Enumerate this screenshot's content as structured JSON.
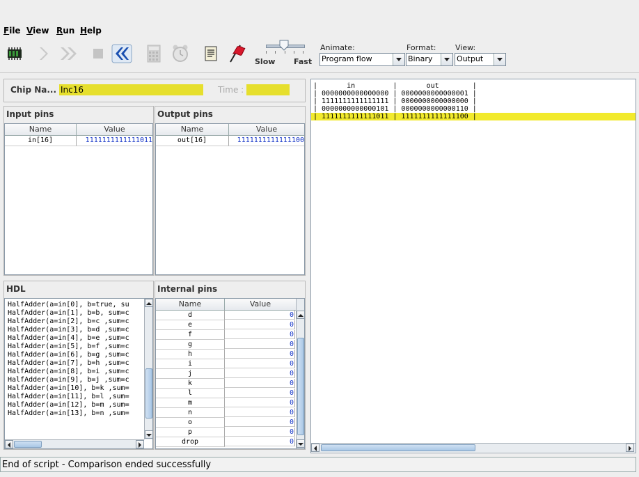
{
  "menu": {
    "file": {
      "accel": "F",
      "rest": "ile"
    },
    "view": {
      "accel": "V",
      "rest": "iew"
    },
    "run": {
      "accel": "R",
      "rest": "un"
    },
    "help": {
      "accel": "H",
      "rest": "elp"
    }
  },
  "toolbar": {
    "speed_slow": "Slow",
    "speed_fast": "Fast",
    "animate_label": "Animate:",
    "animate_value": "Program flow",
    "format_label": "Format:",
    "format_value": "Binary",
    "view_label": "View:",
    "view_value": "Output"
  },
  "chip": {
    "name_label": "Chip Na...",
    "name_value": "Inc16",
    "time_label": "Time :",
    "time_value": ""
  },
  "input_pins": {
    "title": "Input pins",
    "col_name": "Name",
    "col_value": "Value",
    "rows": [
      {
        "name": "in[16]",
        "value": "1111111111111011"
      }
    ]
  },
  "output_pins": {
    "title": "Output pins",
    "col_name": "Name",
    "col_value": "Value",
    "rows": [
      {
        "name": "out[16]",
        "value": "1111111111111100"
      }
    ]
  },
  "hdl": {
    "title": "HDL",
    "lines": [
      "HalfAdder(a=in[0], b=true, su",
      "HalfAdder(a=in[1], b=b, sum=c",
      "HalfAdder(a=in[2], b=c ,sum=c",
      "HalfAdder(a=in[3], b=d ,sum=c",
      "HalfAdder(a=in[4], b=e ,sum=c",
      "HalfAdder(a=in[5], b=f ,sum=c",
      "HalfAdder(a=in[6], b=g ,sum=c",
      "HalfAdder(a=in[7], b=h ,sum=c",
      "HalfAdder(a=in[8], b=i ,sum=c",
      "HalfAdder(a=in[9], b=j ,sum=c",
      "HalfAdder(a=in[10], b=k ,sum=",
      "HalfAdder(a=in[11], b=l ,sum=",
      "HalfAdder(a=in[12], b=m ,sum=",
      "HalfAdder(a=in[13], b=n ,sum="
    ]
  },
  "internal_pins": {
    "title": "Internal pins",
    "col_name": "Name",
    "col_value": "Value",
    "rows": [
      {
        "name": "d",
        "value": "0"
      },
      {
        "name": "e",
        "value": "0"
      },
      {
        "name": "f",
        "value": "0"
      },
      {
        "name": "g",
        "value": "0"
      },
      {
        "name": "h",
        "value": "0"
      },
      {
        "name": "i",
        "value": "0"
      },
      {
        "name": "j",
        "value": "0"
      },
      {
        "name": "k",
        "value": "0"
      },
      {
        "name": "l",
        "value": "0"
      },
      {
        "name": "m",
        "value": "0"
      },
      {
        "name": "n",
        "value": "0"
      },
      {
        "name": "o",
        "value": "0"
      },
      {
        "name": "p",
        "value": "0"
      },
      {
        "name": "drop",
        "value": "0"
      }
    ]
  },
  "output_file": {
    "lines": [
      "|       in         |       out        |",
      "| 0000000000000000 | 0000000000000001 |",
      "| 1111111111111111 | 0000000000000000 |",
      "| 0000000000000101 | 0000000000000110 |",
      "| 1111111111111011 | 1111111111111100 |"
    ],
    "highlight_index": 4
  },
  "status": "End of script - Comparison ended successfully",
  "colors": {
    "highlight": "#f2ea2c",
    "value_blue": "#1636c8",
    "chip_field": "#e6df2d"
  }
}
